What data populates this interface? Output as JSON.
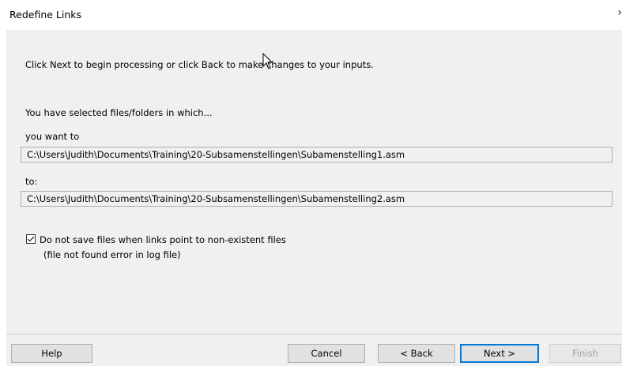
{
  "window": {
    "title": "Redefine Links",
    "close_glyph": "›"
  },
  "content": {
    "instruction": "Click Next to begin processing or click Back to make changes to your inputs.",
    "selected_intro": "You have selected files/folders in which...",
    "want_label": "you want to",
    "from_path": "C:\\Users\\Judith\\Documents\\Training\\20-Subsamenstellingen\\Subamenstelling1.asm",
    "to_label": "to:",
    "to_path": "C:\\Users\\Judith\\Documents\\Training\\20-Subsamenstellingen\\Subamenstelling2.asm",
    "checkbox_label": "Do not save files when links point to non-existent files",
    "checkbox_subtext": "(file not found error in log file)",
    "checkbox_checked": true
  },
  "buttons": {
    "help": "Help",
    "cancel": "Cancel",
    "back": "< Back",
    "next": "Next >",
    "finish": "Finish"
  },
  "colors": {
    "panel_bg": "#f0f0f0",
    "focus_border": "#0078d7"
  }
}
